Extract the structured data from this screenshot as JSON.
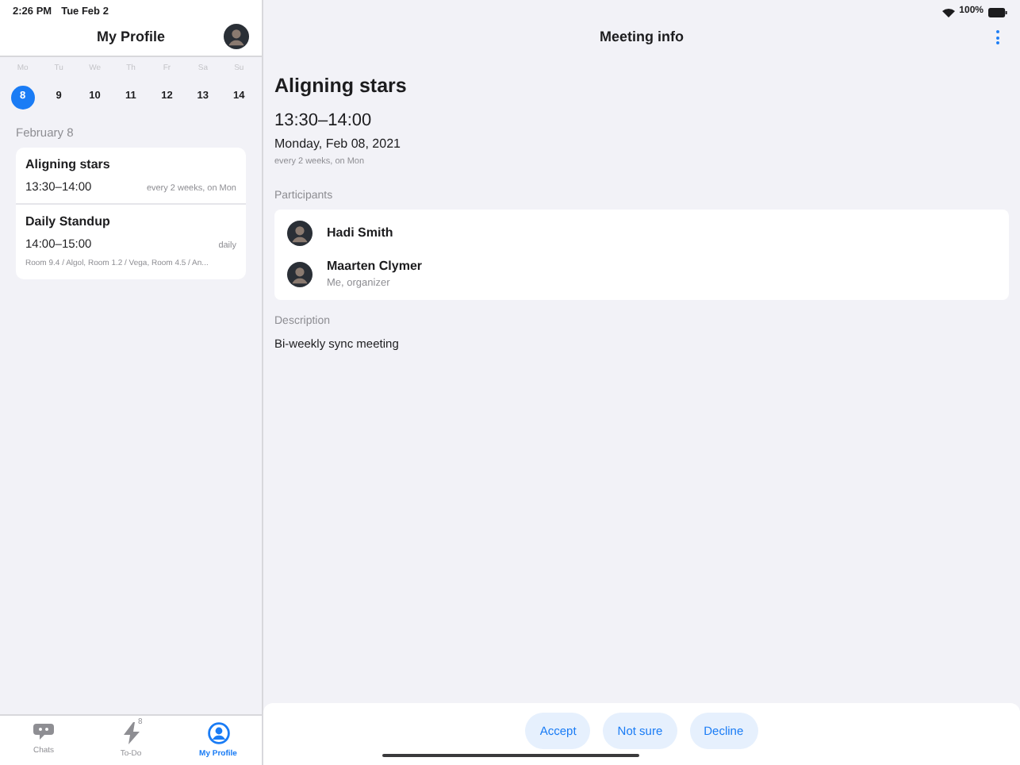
{
  "status_bar": {
    "time": "2:26 PM",
    "date": "Tue Feb 2",
    "battery": "100%"
  },
  "sidebar": {
    "title": "My Profile",
    "week": [
      {
        "weekday": "Mo",
        "day": "8",
        "selected": true
      },
      {
        "weekday": "Tu",
        "day": "9",
        "selected": false
      },
      {
        "weekday": "We",
        "day": "10",
        "selected": false
      },
      {
        "weekday": "Th",
        "day": "11",
        "selected": false
      },
      {
        "weekday": "Fr",
        "day": "12",
        "selected": false
      },
      {
        "weekday": "Sa",
        "day": "13",
        "selected": false
      },
      {
        "weekday": "Su",
        "day": "14",
        "selected": false
      }
    ],
    "section": "February 8",
    "events": [
      {
        "title": "Aligning stars",
        "time": "13:30–14:00",
        "repeat": "every 2 weeks, on Mon"
      },
      {
        "title": "Daily Standup",
        "time": "14:00–15:00",
        "repeat": "daily",
        "location": "Room 9.4 / Algol, Room 1.2 / Vega, Room 4.5 / An..."
      }
    ]
  },
  "tab_bar": [
    {
      "kind": "chats",
      "label": "Chats",
      "selected": false
    },
    {
      "kind": "todo",
      "label": "To-Do",
      "badge": "8",
      "selected": false
    },
    {
      "kind": "profile",
      "label": "My Profile",
      "selected": true
    }
  ],
  "detail": {
    "title": "Meeting info",
    "meeting": "Aligning stars",
    "time": "13:30–14:00",
    "date": "Monday, Feb 08, 2021",
    "repeat": "every 2 weeks, on Mon",
    "participants_label": "Participants",
    "participants": [
      {
        "name": "Hadi Smith"
      },
      {
        "name": "Maarten Clymer",
        "role": "Me, organizer"
      }
    ],
    "description_label": "Description",
    "description": "Bi-weekly sync meeting"
  },
  "actions": [
    "Accept",
    "Not sure",
    "Decline"
  ]
}
